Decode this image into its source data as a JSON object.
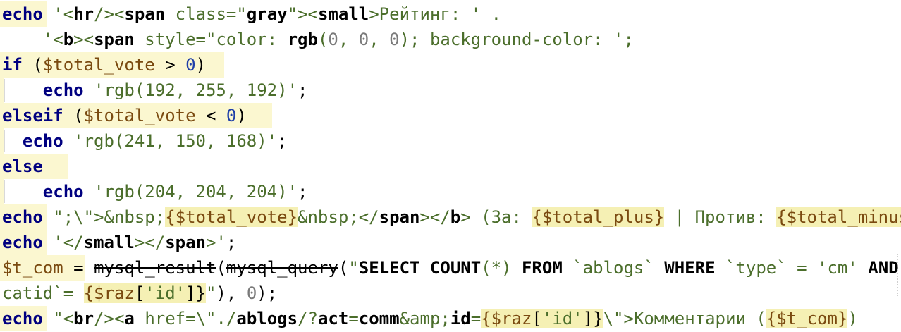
{
  "editor": {
    "lines": [
      {
        "parts": [
          {
            "t": "echo",
            "c": "kw"
          },
          {
            "t": " '<",
            "c": "s"
          },
          {
            "t": "hr",
            "c": "tag"
          },
          {
            "t": "/><",
            "c": "s"
          },
          {
            "t": "span",
            "c": "tag"
          },
          {
            "t": " class=\"",
            "c": "s"
          },
          {
            "t": "gray",
            "c": "tag"
          },
          {
            "t": "\"><",
            "c": "s"
          },
          {
            "t": "small",
            "c": "tag"
          },
          {
            "t": ">Рейтинг: ' .",
            "c": "s"
          }
        ]
      },
      {
        "parts": [
          {
            "t": "    '<",
            "c": "s"
          },
          {
            "t": "b",
            "c": "tag"
          },
          {
            "t": "><",
            "c": "s"
          },
          {
            "t": "span",
            "c": "tag"
          },
          {
            "t": " style=\"color: ",
            "c": "s"
          },
          {
            "t": "rgb",
            "c": "tag"
          },
          {
            "t": "(",
            "c": "s"
          },
          {
            "t": "0",
            "c": "gray-g"
          },
          {
            "t": ", ",
            "c": "s"
          },
          {
            "t": "0",
            "c": "gray-g"
          },
          {
            "t": ", ",
            "c": "s"
          },
          {
            "t": "0",
            "c": "gray-g"
          },
          {
            "t": "); background-color: ';",
            "c": "s"
          }
        ]
      },
      {
        "parts": [
          {
            "t": "if",
            "c": "kw"
          },
          {
            "t": " (",
            "c": ""
          },
          {
            "t": "$total_vote",
            "c": "v"
          },
          {
            "t": " > ",
            "c": ""
          },
          {
            "t": "0",
            "c": "num"
          },
          {
            "t": ")",
            "c": ""
          }
        ]
      },
      {
        "parts": [
          {
            "t": "    ",
            "c": ""
          },
          {
            "t": "echo",
            "c": "kw"
          },
          {
            "t": " 'rgb(192, 255, 192)'",
            "c": "s"
          },
          {
            "t": ";",
            "c": ""
          }
        ]
      },
      {
        "parts": [
          {
            "t": "elseif",
            "c": "kw"
          },
          {
            "t": " (",
            "c": ""
          },
          {
            "t": "$total_vote",
            "c": "v"
          },
          {
            "t": " < ",
            "c": ""
          },
          {
            "t": "0",
            "c": "num"
          },
          {
            "t": ")",
            "c": ""
          }
        ]
      },
      {
        "parts": [
          {
            "t": "  ",
            "c": ""
          },
          {
            "t": "echo",
            "c": "kw"
          },
          {
            "t": " 'rgb(241, 150, 168)'",
            "c": "s"
          },
          {
            "t": ";",
            "c": ""
          }
        ]
      },
      {
        "parts": [
          {
            "t": "else",
            "c": "kw"
          }
        ]
      },
      {
        "parts": [
          {
            "t": "    ",
            "c": ""
          },
          {
            "t": "echo",
            "c": "kw"
          },
          {
            "t": " 'rgb(204, 204, 204)'",
            "c": "s"
          },
          {
            "t": ";",
            "c": ""
          }
        ]
      },
      {
        "parts": [
          {
            "t": "echo",
            "c": "kw"
          },
          {
            "t": " \";\\\">&nbsp;",
            "c": "s"
          },
          {
            "t": "{$total_vote}",
            "c": "v ib"
          },
          {
            "t": "&nbsp;</",
            "c": "s"
          },
          {
            "t": "span",
            "c": "tag"
          },
          {
            "t": "></",
            "c": "s"
          },
          {
            "t": "b",
            "c": "tag"
          },
          {
            "t": "> (За: ",
            "c": "s"
          },
          {
            "t": "{$total_plus}",
            "c": "v ib"
          },
          {
            "t": " | Против: ",
            "c": "s"
          },
          {
            "t": "{$total_minus}",
            "c": "v ib"
          },
          {
            "t": ")",
            "c": "s"
          }
        ]
      },
      {
        "parts": [
          {
            "t": "echo",
            "c": "kw"
          },
          {
            "t": " '</",
            "c": "s"
          },
          {
            "t": "small",
            "c": "tag"
          },
          {
            "t": "></",
            "c": "s"
          },
          {
            "t": "span",
            "c": "tag"
          },
          {
            "t": ">'",
            "c": "s"
          },
          {
            "t": ";",
            "c": ""
          }
        ]
      },
      {
        "parts": [
          {
            "t": "$t_com",
            "c": "v"
          },
          {
            "t": " = ",
            "c": ""
          },
          {
            "t": "mysql_result",
            "c": "strike"
          },
          {
            "t": "(",
            "c": ""
          },
          {
            "t": "mysql_query",
            "c": "strike"
          },
          {
            "t": "(",
            "c": ""
          },
          {
            "t": "\"",
            "c": "s"
          },
          {
            "t": "SELECT",
            "c": "sqword"
          },
          {
            "t": " ",
            "c": "s"
          },
          {
            "t": "COUNT",
            "c": "sqword"
          },
          {
            "t": "(*) ",
            "c": "s"
          },
          {
            "t": "FROM",
            "c": "sqword"
          },
          {
            "t": " `ablogs` ",
            "c": "s"
          },
          {
            "t": "WHERE",
            "c": "sqword"
          },
          {
            "t": " `type` = 'cm' ",
            "c": "s"
          },
          {
            "t": "AND",
            "c": "sqword"
          }
        ]
      },
      {
        "parts": [
          {
            "t": "catid`= ",
            "c": "s"
          },
          {
            "t": "{",
            "c": "v ib"
          },
          {
            "t": "$raz",
            "c": "v ib"
          },
          {
            "t": "[",
            "c": "ib"
          },
          {
            "t": "'id'",
            "c": "s ib"
          },
          {
            "t": "]}",
            "c": "ib"
          },
          {
            "t": "\"",
            "c": "s"
          },
          {
            "t": "), ",
            "c": ""
          },
          {
            "t": "0",
            "c": "gray-g"
          },
          {
            "t": ");",
            "c": ""
          }
        ]
      },
      {
        "parts": [
          {
            "t": "echo",
            "c": "kw"
          },
          {
            "t": " \"<",
            "c": "s"
          },
          {
            "t": "br",
            "c": "tag"
          },
          {
            "t": "/><",
            "c": "s"
          },
          {
            "t": "a",
            "c": "tag"
          },
          {
            "t": " href=\\\"./",
            "c": "s"
          },
          {
            "t": "ablogs",
            "c": "tag"
          },
          {
            "t": "/?",
            "c": "s"
          },
          {
            "t": "act",
            "c": "tag"
          },
          {
            "t": "=",
            "c": "s"
          },
          {
            "t": "comm",
            "c": "tag"
          },
          {
            "t": "&amp;",
            "c": "s"
          },
          {
            "t": "id",
            "c": "tag"
          },
          {
            "t": "=",
            "c": "s"
          },
          {
            "t": "{",
            "c": "v ib"
          },
          {
            "t": "$raz",
            "c": "v ib"
          },
          {
            "t": "[",
            "c": "ib"
          },
          {
            "t": "'id'",
            "c": "s ib"
          },
          {
            "t": "]}",
            "c": "ib"
          },
          {
            "t": "\\\">Комментарии (",
            "c": "s"
          },
          {
            "t": "{$t_com}",
            "c": "v ib"
          },
          {
            "t": ")",
            "c": "s"
          }
        ]
      }
    ]
  }
}
